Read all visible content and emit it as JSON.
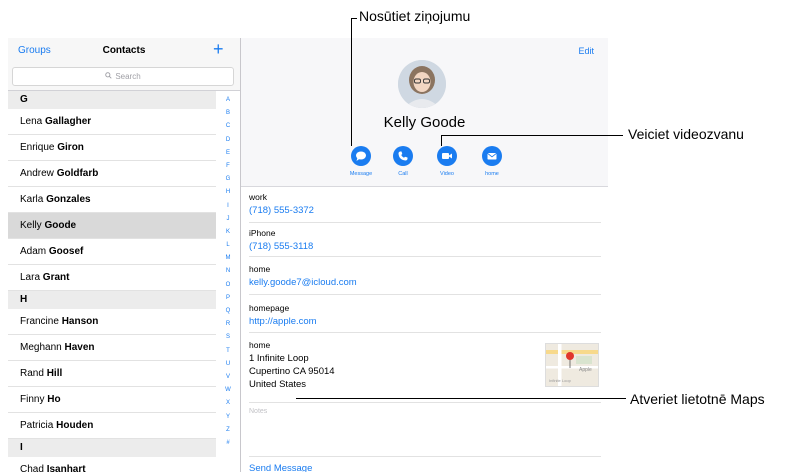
{
  "callouts": {
    "message": "Nosūtiet ziņojumu",
    "video": "Veiciet videozvanu",
    "maps": "Atveriet lietotnē Maps"
  },
  "sidebar": {
    "groups": "Groups",
    "title": "Contacts",
    "add": "+",
    "search_placeholder": "Search",
    "sections": [
      {
        "letter": "G",
        "rows": [
          {
            "first": "Lena ",
            "last": "Gallagher"
          },
          {
            "first": "Enrique ",
            "last": "Giron"
          },
          {
            "first": "Andrew ",
            "last": "Goldfarb"
          },
          {
            "first": "Karla ",
            "last": "Gonzales"
          },
          {
            "first": "Kelly ",
            "last": "Goode",
            "selected": true
          },
          {
            "first": "Adam ",
            "last": "Goosef"
          },
          {
            "first": "Lara ",
            "last": "Grant"
          }
        ]
      },
      {
        "letter": "H",
        "rows": [
          {
            "first": "Francine ",
            "last": "Hanson"
          },
          {
            "first": "Meghann ",
            "last": "Haven"
          },
          {
            "first": "Rand ",
            "last": "Hill"
          },
          {
            "first": "Finny ",
            "last": "Ho"
          },
          {
            "first": "Patricia ",
            "last": "Houden"
          }
        ]
      },
      {
        "letter": "I",
        "rows": [
          {
            "first": "Chad ",
            "last": "Isanhart"
          }
        ]
      }
    ],
    "index_letters": [
      "A",
      "B",
      "C",
      "D",
      "E",
      "F",
      "G",
      "H",
      "I",
      "J",
      "K",
      "L",
      "M",
      "N",
      "O",
      "P",
      "Q",
      "R",
      "S",
      "T",
      "U",
      "V",
      "W",
      "X",
      "Y",
      "Z",
      "#"
    ]
  },
  "detail": {
    "edit": "Edit",
    "name": "Kelly Goode",
    "actions": {
      "message": "Message",
      "call": "Call",
      "video": "Video",
      "mail": "home"
    },
    "fields": {
      "work_label": "work",
      "work_value": "(718) 555-3372",
      "iphone_label": "iPhone",
      "iphone_value": "(718) 555-3118",
      "email_label": "home",
      "email_value": "kelly.goode7@icloud.com",
      "homepage_label": "homepage",
      "homepage_value": "http://apple.com",
      "address_label": "home",
      "address_line1": "1 Infinite Loop",
      "address_line2": "Cupertino CA 95014",
      "address_line3": "United States"
    },
    "map_label": "Apple",
    "map_street": "Infinite Loop",
    "notes": "Notes",
    "send_message": "Send Message"
  },
  "colors": {
    "accent": "#1a7cf0",
    "selected_row": "#d9d9d9",
    "section_bg": "#ececec"
  }
}
